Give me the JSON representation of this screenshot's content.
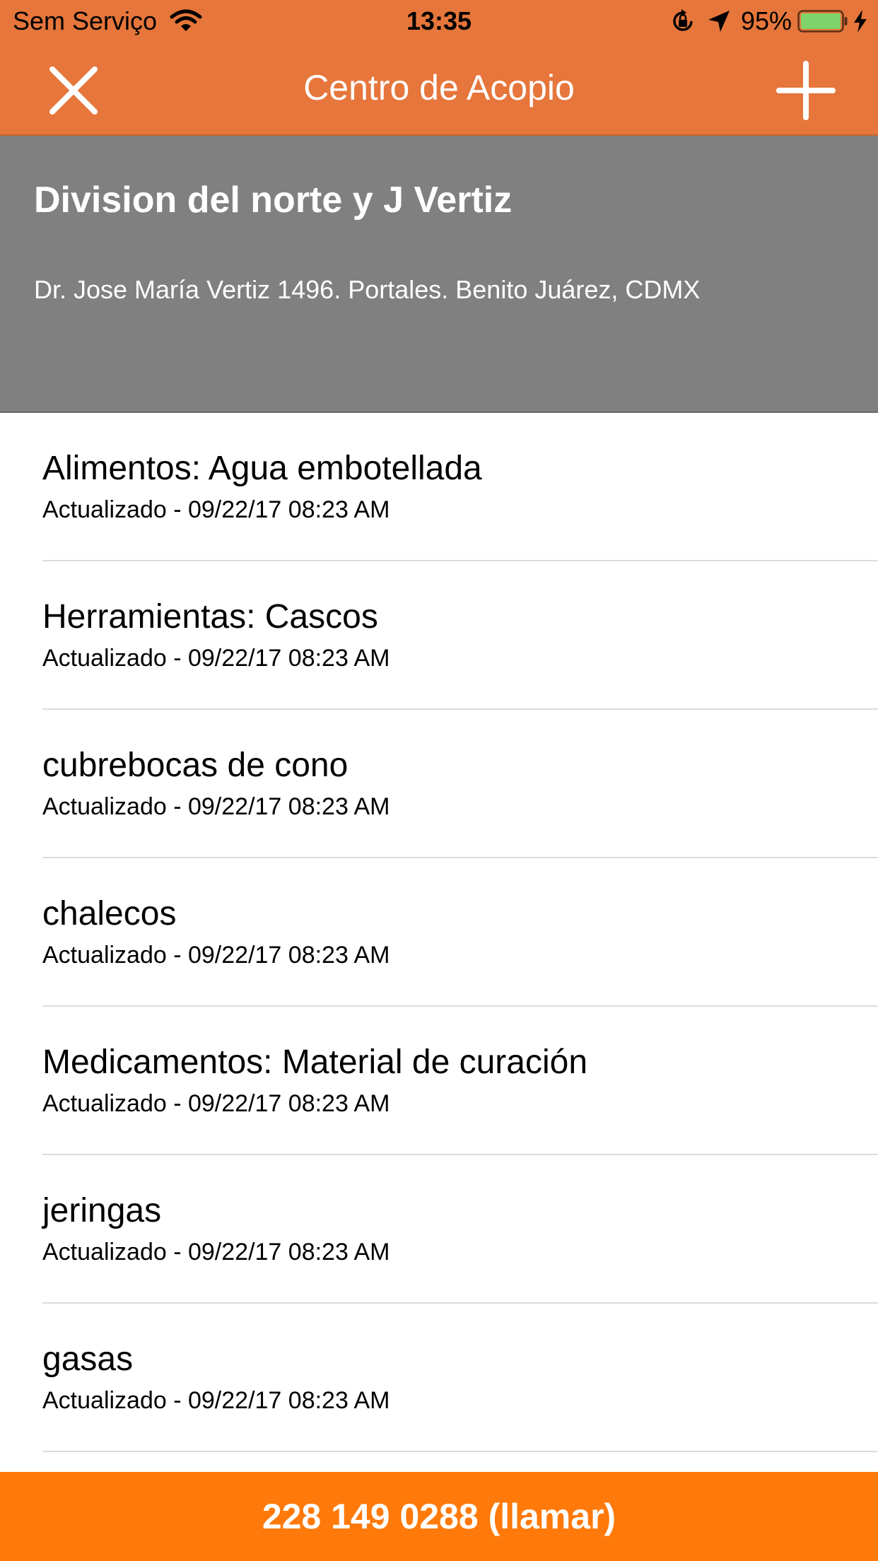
{
  "status_bar": {
    "carrier": "Sem Serviço",
    "time": "13:35",
    "battery": "95%",
    "icons": [
      "wifi-icon",
      "rotation-lock-icon",
      "location-arrow-icon",
      "battery-icon",
      "charging-bolt-icon"
    ]
  },
  "nav": {
    "title": "Centro de Acopio",
    "close_icon": "close-icon",
    "add_icon": "plus-icon"
  },
  "header": {
    "name": "Division del norte y J Vertiz",
    "address": "Dr. Jose María Vertiz 1496. Portales. Benito Juárez, CDMX"
  },
  "items": [
    {
      "title": "Alimentos: Agua embotellada",
      "updated": "Actualizado - 09/22/17 08:23 AM"
    },
    {
      "title": "Herramientas: Cascos",
      "updated": "Actualizado - 09/22/17 08:23 AM"
    },
    {
      "title": "cubrebocas de cono",
      "updated": "Actualizado - 09/22/17 08:23 AM"
    },
    {
      "title": "chalecos",
      "updated": "Actualizado - 09/22/17 08:23 AM"
    },
    {
      "title": "Medicamentos: Material de curación",
      "updated": "Actualizado - 09/22/17 08:23 AM"
    },
    {
      "title": "jeringas",
      "updated": "Actualizado - 09/22/17 08:23 AM"
    },
    {
      "title": "gasas",
      "updated": "Actualizado - 09/22/17 08:23 AM"
    }
  ],
  "call_button": {
    "label": "228 149 0288 (llamar)"
  },
  "colors": {
    "nav_background": "#e6763b",
    "header_background": "#808080",
    "call_button_background": "#ff7a0a",
    "battery_fill": "#7ed36b"
  }
}
